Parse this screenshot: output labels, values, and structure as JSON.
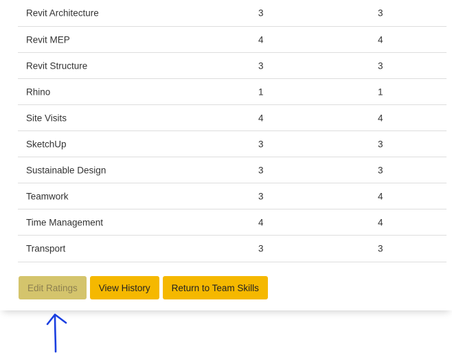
{
  "table": {
    "rows": [
      {
        "skill": "Revit Architecture",
        "rating1": "3",
        "rating2": "3"
      },
      {
        "skill": "Revit MEP",
        "rating1": "4",
        "rating2": "4"
      },
      {
        "skill": "Revit Structure",
        "rating1": "3",
        "rating2": "3"
      },
      {
        "skill": "Rhino",
        "rating1": "1",
        "rating2": "1"
      },
      {
        "skill": "Site Visits",
        "rating1": "4",
        "rating2": "4"
      },
      {
        "skill": "SketchUp",
        "rating1": "3",
        "rating2": "3"
      },
      {
        "skill": "Sustainable Design",
        "rating1": "3",
        "rating2": "3"
      },
      {
        "skill": "Teamwork",
        "rating1": "3",
        "rating2": "4"
      },
      {
        "skill": "Time Management",
        "rating1": "4",
        "rating2": "4"
      },
      {
        "skill": "Transport",
        "rating1": "3",
        "rating2": "3"
      }
    ]
  },
  "actions": {
    "edit_label": "Edit Ratings",
    "history_label": "View History",
    "return_label": "Return to Team Skills"
  },
  "colors": {
    "button_bg": "#f5b800",
    "button_disabled_bg": "#d4c46c",
    "annotation_arrow": "#1a3fe0"
  },
  "annotation": {
    "icon": "up-arrow-annotation-icon"
  }
}
